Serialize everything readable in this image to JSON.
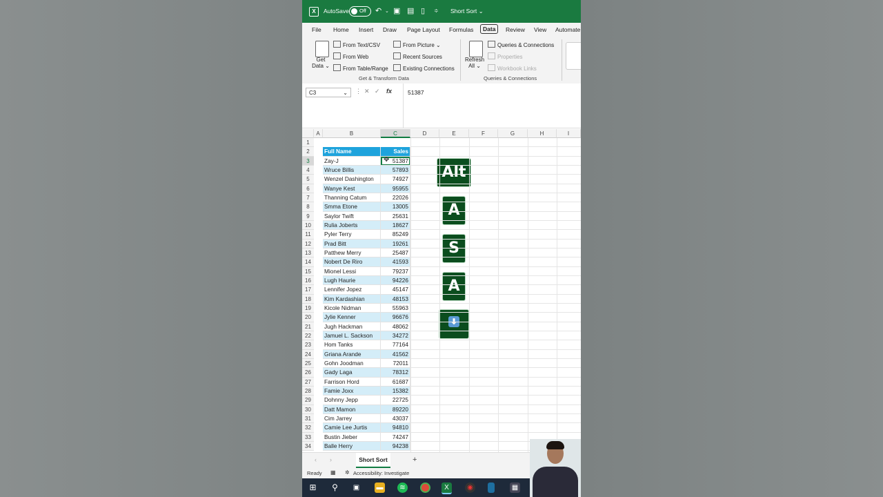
{
  "titlebar": {
    "autosave_label": "AutoSave",
    "toggle_label": "Off",
    "file_name": "Short Sort ⌄"
  },
  "tabs": [
    "File",
    "Home",
    "Insert",
    "Draw",
    "Page Layout",
    "Formulas",
    "Data",
    "Review",
    "View",
    "Automate"
  ],
  "ribbon": {
    "get_data": "Get Data ⌄",
    "from_text_csv": "From Text/CSV",
    "from_web": "From Web",
    "from_table_range": "From Table/Range",
    "from_picture": "From Picture ⌄",
    "recent_sources": "Recent Sources",
    "existing_connections": "Existing Connections",
    "group_get_transform": "Get & Transform Data",
    "refresh_all": "Refresh All ⌄",
    "queries_connections": "Queries & Connections",
    "properties": "Properties",
    "workbook_links": "Workbook Links",
    "group_queries": "Queries & Connections"
  },
  "formula_bar": {
    "name_box": "C3",
    "fx": "fx",
    "value": "51387"
  },
  "columns": [
    "A",
    "B",
    "C",
    "D",
    "E",
    "F",
    "G",
    "H",
    "I"
  ],
  "rows": [
    "1",
    "2",
    "3",
    "4",
    "5",
    "6",
    "7",
    "8",
    "9",
    "10",
    "11",
    "12",
    "13",
    "14",
    "15",
    "16",
    "17",
    "18",
    "19",
    "20",
    "21",
    "22",
    "23",
    "24",
    "25",
    "26",
    "27",
    "28",
    "29",
    "30",
    "31",
    "32",
    "33",
    "34"
  ],
  "table": {
    "headers": [
      "Full Name",
      "Sales"
    ],
    "rows": [
      [
        "Zay-J",
        "51387"
      ],
      [
        "Wruce Billis",
        "57893"
      ],
      [
        "Wenzel Dashington",
        "74927"
      ],
      [
        "Wanye Kest",
        "95955"
      ],
      [
        "Thanning Catum",
        "22026"
      ],
      [
        "Smma Etone",
        "13005"
      ],
      [
        "Saylor Twift",
        "25631"
      ],
      [
        "Rulia Joberts",
        "18627"
      ],
      [
        "Pyler Terry",
        "85249"
      ],
      [
        "Prad Bitt",
        "19261"
      ],
      [
        "Patthew Merry",
        "25487"
      ],
      [
        "Nobert De Riro",
        "41593"
      ],
      [
        "Mionel Lessi",
        "79237"
      ],
      [
        "Lugh Haurie",
        "94226"
      ],
      [
        "Lennifer Jopez",
        "45147"
      ],
      [
        "Kim Kardashian",
        "48153"
      ],
      [
        "Kicole Nidman",
        "55963"
      ],
      [
        "Jylie Kenner",
        "96676"
      ],
      [
        "Jugh Hackman",
        "48062"
      ],
      [
        "Jamuel L. Sackson",
        "34272"
      ],
      [
        "Hom Tanks",
        "77164"
      ],
      [
        "Griana Arande",
        "41562"
      ],
      [
        "Gohn Joodman",
        "72011"
      ],
      [
        "Gady Laga",
        "78312"
      ],
      [
        "Farrison Hord",
        "61687"
      ],
      [
        "Famie Joxx",
        "15382"
      ],
      [
        "Dohnny Jepp",
        "22725"
      ],
      [
        "Datt Mamon",
        "89220"
      ],
      [
        "Cim Jarrey",
        "43037"
      ],
      [
        "Camie Lee Jurtis",
        "94810"
      ],
      [
        "Bustin Jieber",
        "74247"
      ],
      [
        "Balle Herry",
        "94238"
      ]
    ]
  },
  "keys": [
    "Alt",
    "A",
    "S",
    "A"
  ],
  "down_key_icon": "down-arrow-key",
  "sheet_tab": "Short Sort",
  "add_sheet": "+",
  "status": {
    "ready": "Ready",
    "accessibility": "Accessibility: Investigate"
  },
  "colors": {
    "excel_green": "#1a7a40",
    "table_header": "#1ea3dc",
    "band": "#d4edf8",
    "key_bg": "#0b4d1e"
  }
}
